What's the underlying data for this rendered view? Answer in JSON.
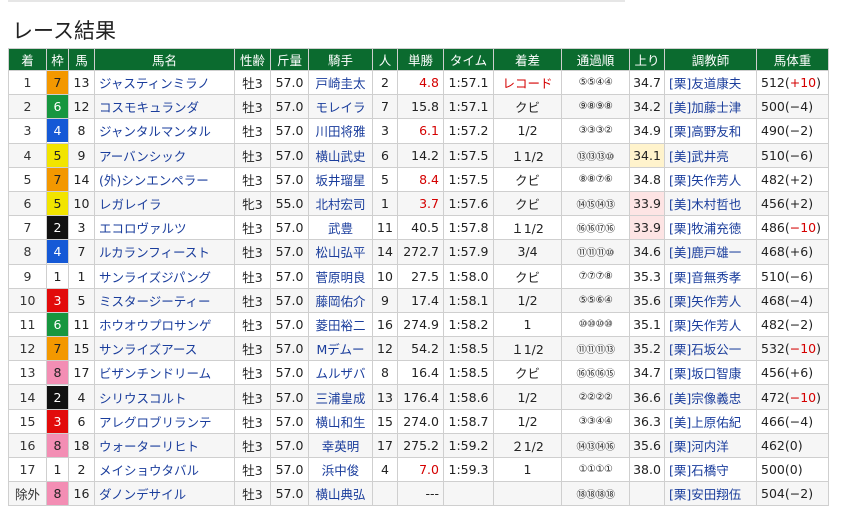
{
  "page": {
    "title": "レース結果"
  },
  "table": {
    "headers": [
      "着",
      "枠",
      "馬",
      "馬名",
      "性齢",
      "斤量",
      "騎手",
      "人",
      "単勝",
      "タイム",
      "着差",
      "通過順",
      "上り",
      "調教師",
      "馬体重"
    ],
    "rows": [
      {
        "pos": "1",
        "waku": "7",
        "num": "13",
        "horse": "ジャスティンミラノ",
        "sexage": "牡3",
        "weight": "57.0",
        "jockey": "戸崎圭太",
        "pop": "2",
        "odds": "4.8",
        "time": "1:57.1",
        "margin": "レコード",
        "passing": "⑤⑤④④",
        "agari": "34.7",
        "trainer": "[栗]友道康夫",
        "bw": "512(",
        "bwc": "+10",
        "bwe": ")",
        "odds_hot": true,
        "rec": true,
        "bwc_up": true
      },
      {
        "pos": "2",
        "waku": "6",
        "num": "12",
        "horse": "コスモキュランダ",
        "sexage": "牡3",
        "weight": "57.0",
        "jockey": "モレイラ",
        "pop": "7",
        "odds": "15.8",
        "time": "1:57.1",
        "margin": "クビ",
        "passing": "⑨⑧⑨⑧",
        "agari": "34.2",
        "trainer": "[美]加藤士津",
        "bw": "500(",
        "bwc": "−4",
        "bwe": ")"
      },
      {
        "pos": "3",
        "waku": "4",
        "num": "8",
        "horse": "ジャンタルマンタル",
        "sexage": "牡3",
        "weight": "57.0",
        "jockey": "川田将雅",
        "pop": "3",
        "odds": "6.1",
        "time": "1:57.2",
        "margin": "1/2",
        "passing": "③③③②",
        "agari": "34.9",
        "trainer": "[栗]高野友和",
        "bw": "490(",
        "bwc": "−2",
        "bwe": ")",
        "odds_hot": true
      },
      {
        "pos": "4",
        "waku": "5",
        "num": "9",
        "horse": "アーバンシック",
        "sexage": "牡3",
        "weight": "57.0",
        "jockey": "横山武史",
        "pop": "6",
        "odds": "14.2",
        "time": "1:57.5",
        "margin": "１1/2",
        "passing": "⑬⑬⑬⑩",
        "agari": "34.1",
        "trainer": "[美]武井亮",
        "bw": "510(",
        "bwc": "−6",
        "bwe": ")",
        "agari_rank": "top"
      },
      {
        "pos": "5",
        "waku": "7",
        "num": "14",
        "horse": "(外)シンエンペラー",
        "sexage": "牡3",
        "weight": "57.0",
        "jockey": "坂井瑠星",
        "pop": "5",
        "odds": "8.4",
        "time": "1:57.5",
        "margin": "クビ",
        "passing": "⑧⑧⑦⑥",
        "agari": "34.8",
        "trainer": "[栗]矢作芳人",
        "bw": "482(",
        "bwc": "+2",
        "bwe": ")",
        "odds_hot": true
      },
      {
        "pos": "6",
        "waku": "5",
        "num": "10",
        "horse": "レガレイラ",
        "sexage": "牝3",
        "weight": "55.0",
        "jockey": "北村宏司",
        "pop": "1",
        "odds": "3.7",
        "time": "1:57.6",
        "margin": "クビ",
        "passing": "⑭⑮⑭⑬",
        "agari": "33.9",
        "trainer": "[美]木村哲也",
        "bw": "456(",
        "bwc": "+2",
        "bwe": ")",
        "odds_hot": true,
        "agari_rank": "second"
      },
      {
        "pos": "7",
        "waku": "2",
        "num": "3",
        "horse": "エコロヴァルツ",
        "sexage": "牡3",
        "weight": "57.0",
        "jockey": "武豊",
        "pop": "11",
        "odds": "40.5",
        "time": "1:57.8",
        "margin": "１1/2",
        "passing": "⑯⑯⑰⑯",
        "agari": "33.9",
        "trainer": "[栗]牧浦充徳",
        "bw": "486(",
        "bwc": "−10",
        "bwe": ")",
        "agari_rank": "second",
        "bwc_up": true
      },
      {
        "pos": "8",
        "waku": "4",
        "num": "7",
        "horse": "ルカランフィースト",
        "sexage": "牡3",
        "weight": "57.0",
        "jockey": "松山弘平",
        "pop": "14",
        "odds": "272.7",
        "time": "1:57.9",
        "margin": "3/4",
        "passing": "⑪⑪⑪⑩",
        "agari": "34.6",
        "trainer": "[美]鹿戸雄一",
        "bw": "468(",
        "bwc": "+6",
        "bwe": ")"
      },
      {
        "pos": "9",
        "waku": "1",
        "num": "1",
        "horse": "サンライズジパング",
        "sexage": "牡3",
        "weight": "57.0",
        "jockey": "菅原明良",
        "pop": "10",
        "odds": "27.5",
        "time": "1:58.0",
        "margin": "クビ",
        "passing": "⑦⑦⑦⑧",
        "agari": "35.3",
        "trainer": "[栗]音無秀孝",
        "bw": "510(",
        "bwc": "−6",
        "bwe": ")"
      },
      {
        "pos": "10",
        "waku": "3",
        "num": "5",
        "horse": "ミスタージーティー",
        "sexage": "牡3",
        "weight": "57.0",
        "jockey": "藤岡佑介",
        "pop": "9",
        "odds": "17.4",
        "time": "1:58.1",
        "margin": "1/2",
        "passing": "⑤⑤⑥④",
        "agari": "35.6",
        "trainer": "[栗]矢作芳人",
        "bw": "468(",
        "bwc": "−4",
        "bwe": ")"
      },
      {
        "pos": "11",
        "waku": "6",
        "num": "11",
        "horse": "ホウオウプロサンゲ",
        "sexage": "牡3",
        "weight": "57.0",
        "jockey": "菱田裕二",
        "pop": "16",
        "odds": "274.9",
        "time": "1:58.2",
        "margin": "1",
        "passing": "⑩⑩⑩⑩",
        "agari": "35.1",
        "trainer": "[栗]矢作芳人",
        "bw": "482(",
        "bwc": "−2",
        "bwe": ")"
      },
      {
        "pos": "12",
        "waku": "7",
        "num": "15",
        "horse": "サンライズアース",
        "sexage": "牡3",
        "weight": "57.0",
        "jockey": "Mデムー",
        "pop": "12",
        "odds": "54.2",
        "time": "1:58.5",
        "margin": "１1/2",
        "passing": "⑪⑪⑪⑬",
        "agari": "35.2",
        "trainer": "[栗]石坂公一",
        "bw": "532(",
        "bwc": "−10",
        "bwe": ")",
        "bwc_up": true
      },
      {
        "pos": "13",
        "waku": "8",
        "num": "17",
        "horse": "ビザンチンドリーム",
        "sexage": "牡3",
        "weight": "57.0",
        "jockey": "ムルザバ",
        "pop": "8",
        "odds": "16.4",
        "time": "1:58.5",
        "margin": "クビ",
        "passing": "⑯⑯⑯⑮",
        "agari": "34.7",
        "trainer": "[栗]坂口智康",
        "bw": "456(",
        "bwc": "+6",
        "bwe": ")"
      },
      {
        "pos": "14",
        "waku": "2",
        "num": "4",
        "horse": "シリウスコルト",
        "sexage": "牡3",
        "weight": "57.0",
        "jockey": "三浦皇成",
        "pop": "13",
        "odds": "176.4",
        "time": "1:58.6",
        "margin": "1/2",
        "passing": "②②②②",
        "agari": "36.6",
        "trainer": "[美]宗像義忠",
        "bw": "472(",
        "bwc": "−10",
        "bwe": ")",
        "bwc_up": true
      },
      {
        "pos": "15",
        "waku": "3",
        "num": "6",
        "horse": "アレグロブリランテ",
        "sexage": "牡3",
        "weight": "57.0",
        "jockey": "横山和生",
        "pop": "15",
        "odds": "274.0",
        "time": "1:58.7",
        "margin": "1/2",
        "passing": "③③④④",
        "agari": "36.3",
        "trainer": "[美]上原佑紀",
        "bw": "466(",
        "bwc": "−4",
        "bwe": ")"
      },
      {
        "pos": "16",
        "waku": "8",
        "num": "18",
        "horse": "ウォーターリヒト",
        "sexage": "牡3",
        "weight": "57.0",
        "jockey": "幸英明",
        "pop": "17",
        "odds": "275.2",
        "time": "1:59.2",
        "margin": "２1/2",
        "passing": "⑭⑬⑭⑯",
        "agari": "35.6",
        "trainer": "[栗]河内洋",
        "bw": "462(",
        "bwc": "0",
        "bwe": ")"
      },
      {
        "pos": "17",
        "waku": "1",
        "num": "2",
        "horse": "メイショウタバル",
        "sexage": "牡3",
        "weight": "57.0",
        "jockey": "浜中俊",
        "pop": "4",
        "odds": "7.0",
        "time": "1:59.3",
        "margin": "1",
        "passing": "①①①①",
        "agari": "38.0",
        "trainer": "[栗]石橋守",
        "bw": "500(",
        "bwc": "0",
        "bwe": ")",
        "odds_hot": true
      },
      {
        "pos": "除外",
        "waku": "8",
        "num": "16",
        "horse": "ダノンデサイル",
        "sexage": "牡3",
        "weight": "57.0",
        "jockey": "横山典弘",
        "pop": "",
        "odds": "---",
        "time": "",
        "margin": "",
        "passing": "⑱⑱⑱⑱",
        "agari": "",
        "trainer": "[栗]安田翔伍",
        "bw": "504(",
        "bwc": "−2",
        "bwe": ")"
      }
    ]
  }
}
